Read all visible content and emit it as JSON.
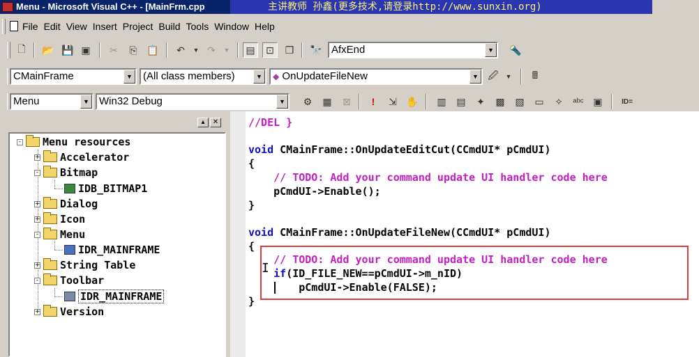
{
  "window": {
    "title": "Menu - Microsoft Visual C++ - [MainFrm.cpp",
    "overlay_text": "主讲教师 孙鑫(更多技术,请登录http://www.sunxin.org)"
  },
  "menubar": {
    "items": [
      {
        "label": "File"
      },
      {
        "label": "Edit"
      },
      {
        "label": "View"
      },
      {
        "label": "Insert"
      },
      {
        "label": "Project"
      },
      {
        "label": "Build"
      },
      {
        "label": "Tools"
      },
      {
        "label": "Window"
      },
      {
        "label": "Help"
      }
    ]
  },
  "toolbar": {
    "find_combo": "AfxEnd"
  },
  "wizardbar": {
    "class_combo": "CMainFrame",
    "filter_combo": "(All class members)",
    "member_combo": "OnUpdateFileNew"
  },
  "buildbar": {
    "project_combo": "Menu",
    "config_combo": "Win32 Debug",
    "id_label": "ID="
  },
  "workspace": {
    "tree": [
      {
        "label": "Menu resources",
        "level": 0,
        "state": "-"
      },
      {
        "label": "Accelerator",
        "level": 1,
        "state": "+"
      },
      {
        "label": "Bitmap",
        "level": 1,
        "state": "-"
      },
      {
        "label": "IDB_BITMAP1",
        "level": 2,
        "state": ""
      },
      {
        "label": "Dialog",
        "level": 1,
        "state": "+"
      },
      {
        "label": "Icon",
        "level": 1,
        "state": "+"
      },
      {
        "label": "Menu",
        "level": 1,
        "state": "-"
      },
      {
        "label": "IDR_MAINFRAME",
        "level": 2,
        "state": ""
      },
      {
        "label": "String Table",
        "level": 1,
        "state": "+"
      },
      {
        "label": "Toolbar",
        "level": 1,
        "state": "-"
      },
      {
        "label": "IDR_MAINFRAME",
        "level": 2,
        "state": "",
        "selected": true
      },
      {
        "label": "Version",
        "level": 1,
        "state": "+"
      }
    ]
  },
  "editor": {
    "lines": {
      "l1": "//DEL }",
      "l2_kw": "void",
      "l2_rest": " CMainFrame::OnUpdateEditCut(CCmdUI* pCmdUI)",
      "l3": "{",
      "l4": "    // TODO: Add your command update UI handler code here",
      "l5": "    pCmdUI->Enable();",
      "l6": "}",
      "l7_kw": "void",
      "l7_rest": " CMainFrame::OnUpdateFileNew(CCmdUI* pCmdUI)",
      "l8": "{",
      "l9": "    // TODO: Add your command update UI handler code here",
      "l10_kw": "    if",
      "l10_rest": "(ID_FILE_NEW==pCmdUI->m_nID)",
      "l11": "        pCmdUI->Enable(FALSE);",
      "l12": "}"
    }
  },
  "colors": {
    "keyword": "#1010c0",
    "comment": "#c020c0",
    "highlight_box": "#e03a3a",
    "title_active": "#0a246a"
  }
}
